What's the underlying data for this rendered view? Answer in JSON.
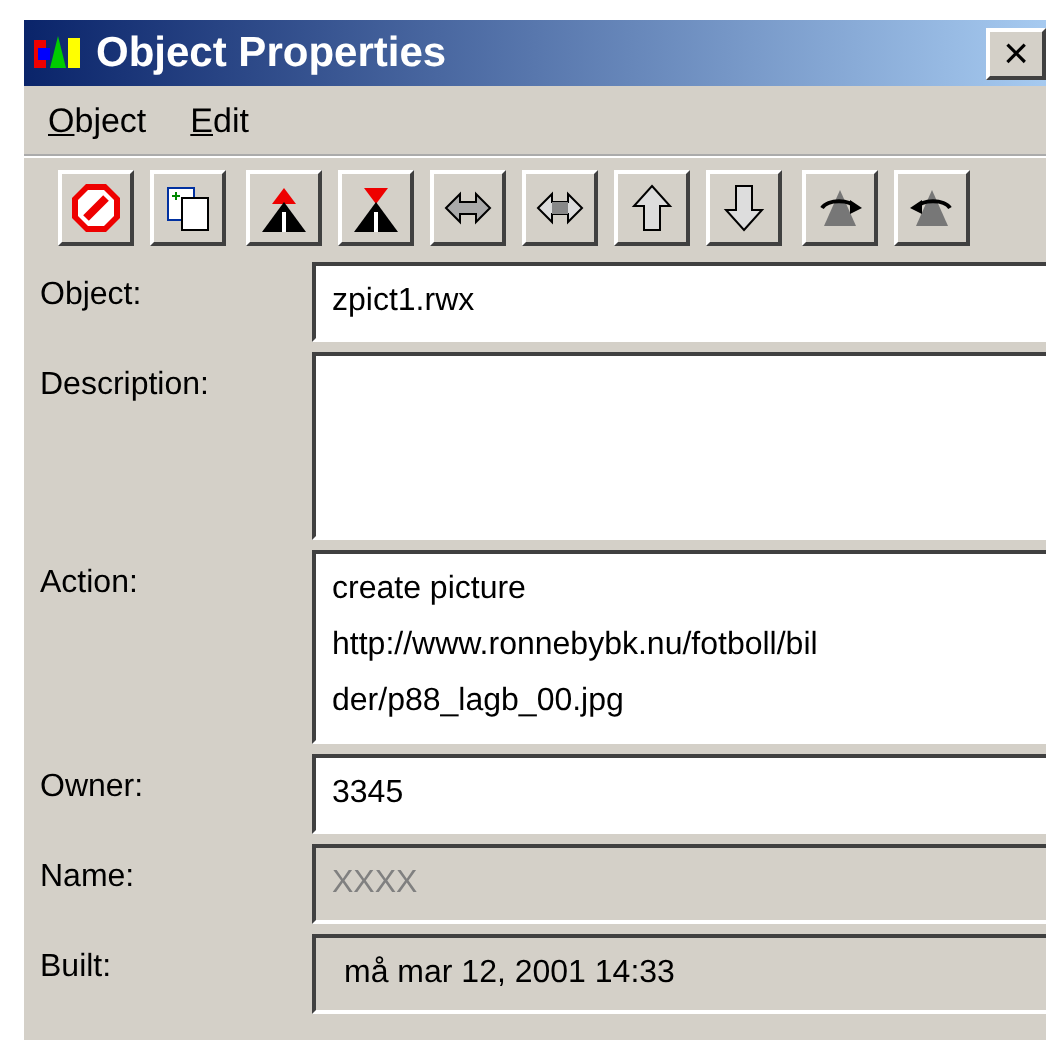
{
  "window": {
    "title": "Object Properties",
    "close": "×"
  },
  "menu": [
    {
      "label": "Object"
    },
    {
      "label": "Edit"
    }
  ],
  "toolbar": [
    [
      {
        "kind": "stop"
      },
      {
        "kind": "copy"
      }
    ],
    [
      {
        "kind": "up-red"
      },
      {
        "kind": "down-red"
      },
      {
        "kind": "move-horizontal"
      },
      {
        "kind": "move-horizontal-alt"
      },
      {
        "kind": "move-up"
      },
      {
        "kind": "move-down"
      }
    ],
    [
      {
        "kind": "rotate-left"
      },
      {
        "kind": "rotate-right"
      }
    ]
  ],
  "fields": [
    {
      "label": "Object:",
      "kind": "line",
      "lines": [
        "zpict1.rwx"
      ],
      "editable": true,
      "disabled": false
    },
    {
      "label": "Description:",
      "kind": "area",
      "editable": true,
      "disabled": false
    },
    {
      "label": "Action:",
      "kind": "area",
      "lines": [
        "create picture",
        "http://www.ronnebybk.nu/fotboll/bil",
        "der/p88_lagb_00.jpg"
      ],
      "editable": true,
      "disabled": false
    },
    {
      "label": "Owner:",
      "kind": "line",
      "lines": [
        "3345"
      ],
      "editable": true,
      "disabled": false
    },
    {
      "label": "Name:",
      "kind": "line",
      "lines": [
        "XXXX"
      ],
      "editable": false,
      "disabled": true
    },
    {
      "label": "Built:",
      "kind": "line",
      "lines": [
        "må mar 12, 2001 14:33"
      ],
      "editable": false,
      "disabled": false
    }
  ]
}
